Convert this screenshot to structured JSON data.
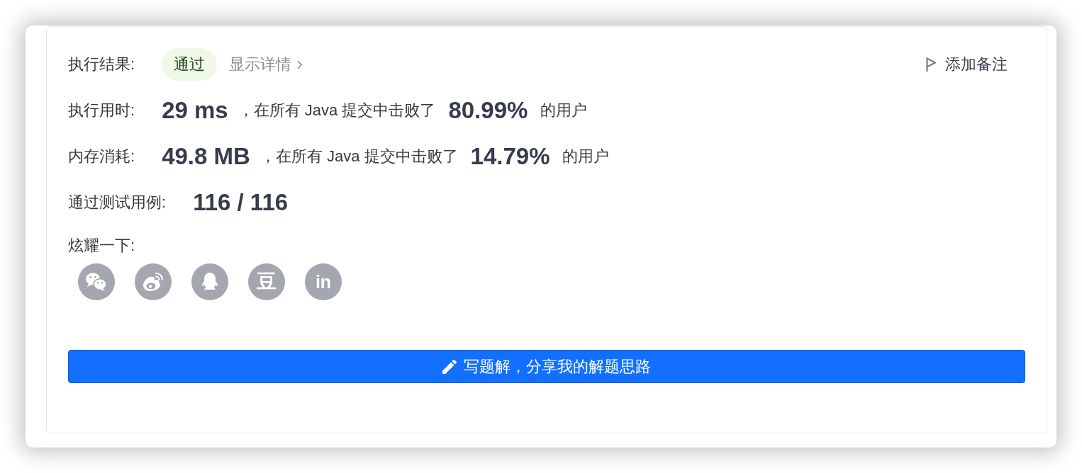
{
  "result": {
    "label": "执行结果:",
    "status": "通过",
    "details_link": "显示详情",
    "note_button": "添加备注"
  },
  "stats": [
    {
      "label": "执行用时:",
      "value": "29 ms",
      "beat_text": "，在所有 Java 提交中击败了",
      "percent": "80.99%",
      "suffix": "的用户"
    },
    {
      "label": "内存消耗:",
      "value": "49.8 MB",
      "beat_text": "，在所有 Java 提交中击败了",
      "percent": "14.79%",
      "suffix": "的用户"
    }
  ],
  "test_cases": {
    "label": "通过测试用例:",
    "value": "116 / 116"
  },
  "share": {
    "label": "炫耀一下:",
    "text_icons": [
      "豆",
      "in"
    ]
  },
  "solution_button": "写题解，分享我的解题思路"
}
